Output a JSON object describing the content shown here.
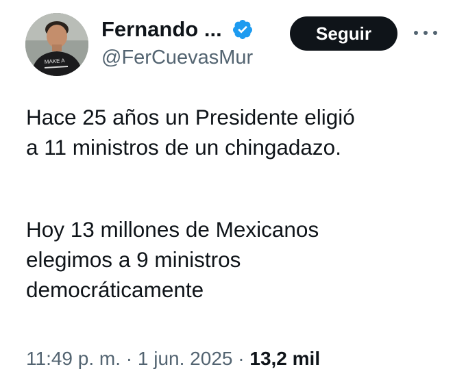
{
  "author": {
    "display_name": "Fernando ...",
    "handle": "@FerCuevasMur",
    "avatar_shirt_text": "MAKE A"
  },
  "follow_button": {
    "label": "Seguir"
  },
  "tweet": {
    "paragraph1": [
      "Hace 25 años un Presidente eligió",
      "a 11 ministros de un chingadazo."
    ],
    "paragraph2": [
      "Hoy 13 millones de Mexicanos",
      "elegimos a 9 ministros",
      "democráticamente"
    ]
  },
  "meta": {
    "time": "11:49 p. m.",
    "separator": " · ",
    "date": "1 jun. 2025",
    "views": "13,2 mil"
  },
  "colors": {
    "text_primary": "#0f1419",
    "text_secondary": "#536471",
    "verified_blue": "#1d9bf0",
    "button_bg": "#0f1419"
  },
  "icons": {
    "verified": "verified-badge-icon",
    "more": "more-options-icon"
  }
}
